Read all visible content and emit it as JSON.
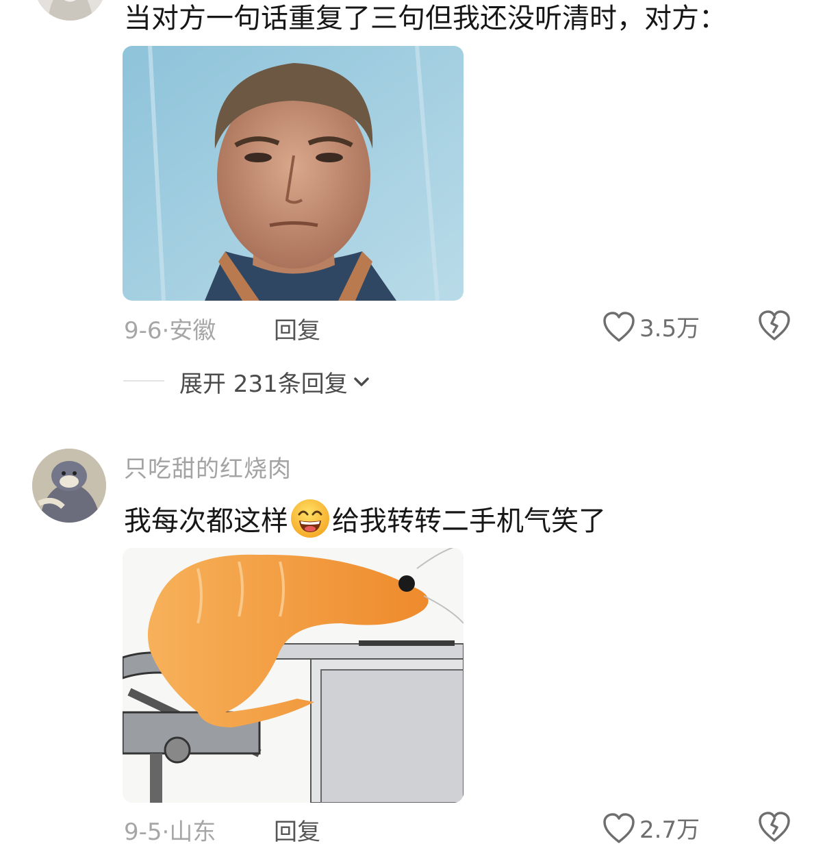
{
  "comments": [
    {
      "text": "当对方一句话重复了三句但我还没听清时，对方：",
      "date": "9-6",
      "location": "安徽",
      "reply_label": "回复",
      "likes": "3.5万",
      "expand_label": "展开 231条回复"
    },
    {
      "username": "只吃甜的红烧肉",
      "text_before_emoji": "我每次都这样",
      "emoji": "grinning-emoji",
      "text_after_emoji": "给我转转二手机气笑了",
      "date": "9-5",
      "location": "山东",
      "reply_label": "回复",
      "likes": "2.7万"
    }
  ],
  "meta_separator": "·",
  "colors": {
    "text": "#161616",
    "muted": "#a6a6a6",
    "shrimp": "#f29a3a",
    "sky": "#9cc9dd"
  }
}
